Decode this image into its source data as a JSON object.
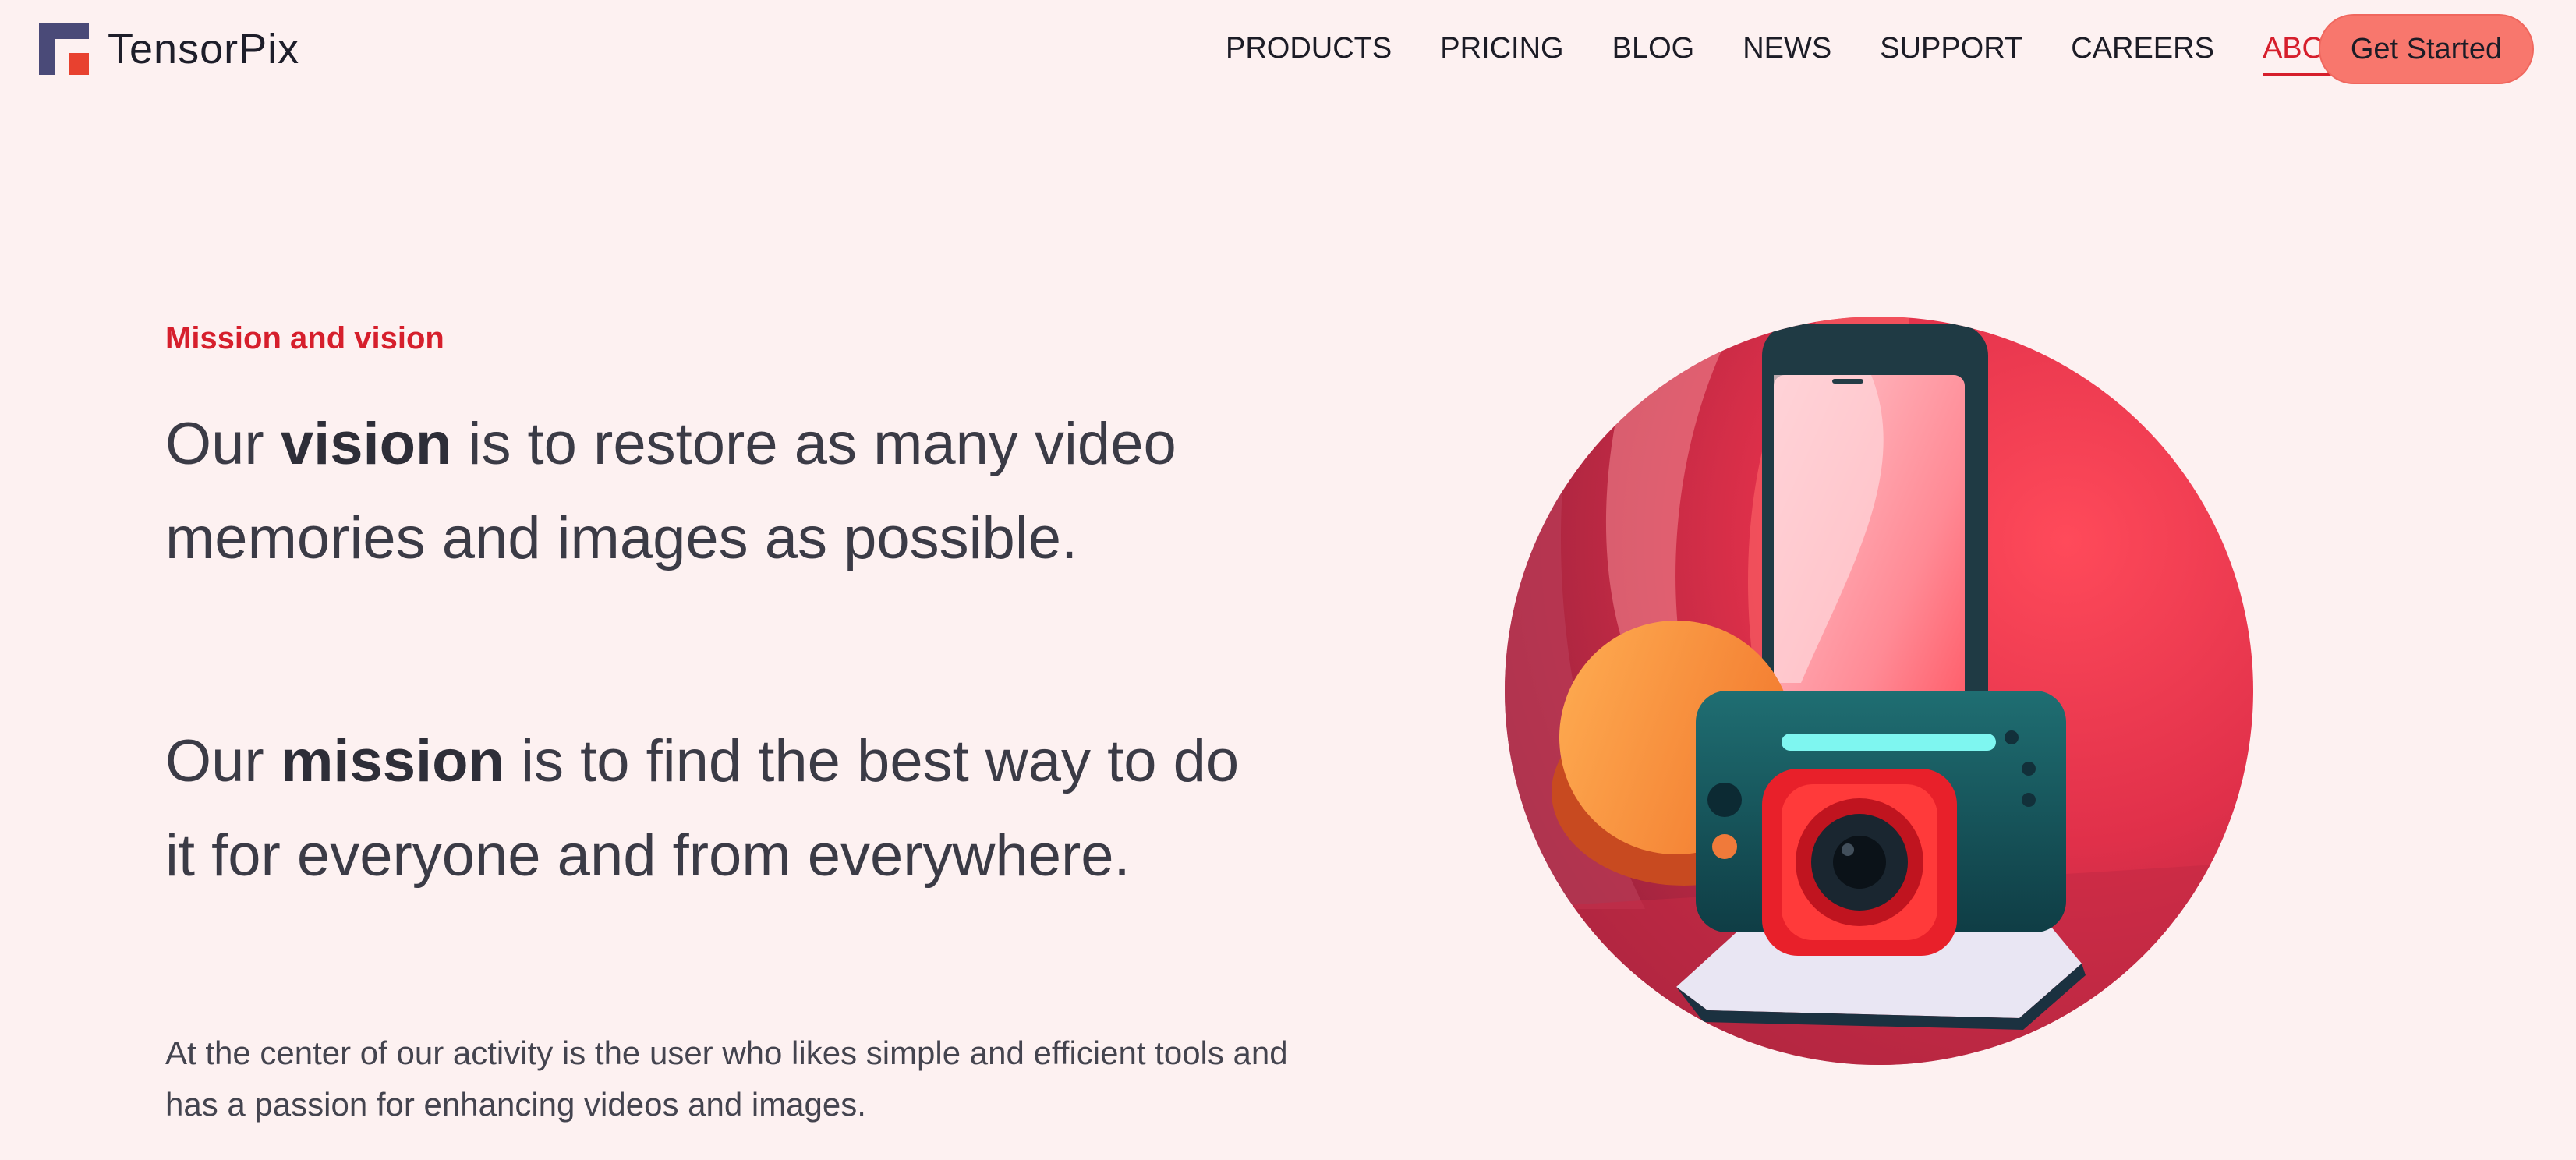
{
  "brand": {
    "name": "TensorPix"
  },
  "nav": {
    "items": [
      {
        "label": "PRODUCTS",
        "active": false
      },
      {
        "label": "PRICING",
        "active": false
      },
      {
        "label": "BLOG",
        "active": false
      },
      {
        "label": "NEWS",
        "active": false
      },
      {
        "label": "SUPPORT",
        "active": false
      },
      {
        "label": "CAREERS",
        "active": false
      },
      {
        "label": "ABOUT",
        "active": true
      }
    ],
    "cta_label": "Get Started"
  },
  "hero": {
    "eyebrow": "Mission and vision",
    "vision": {
      "before": "Our ",
      "keyword": "vision",
      "after": " is to restore as many video memories and images as possible."
    },
    "mission": {
      "before": "Our ",
      "keyword": "mission",
      "after": " is to find the best way to do it for everyone and from everywhere."
    },
    "body": "At the center of our activity is the user who likes simple and efficient tools and has a passion for enhancing videos and images."
  },
  "colors": {
    "background": "#fdf1f1",
    "accent": "#d61f2c",
    "cta": "#f8776d",
    "logo_primary": "#4a4a78",
    "logo_secondary": "#e8412f"
  },
  "illustration": {
    "icon": "phone-camera-illustration"
  }
}
